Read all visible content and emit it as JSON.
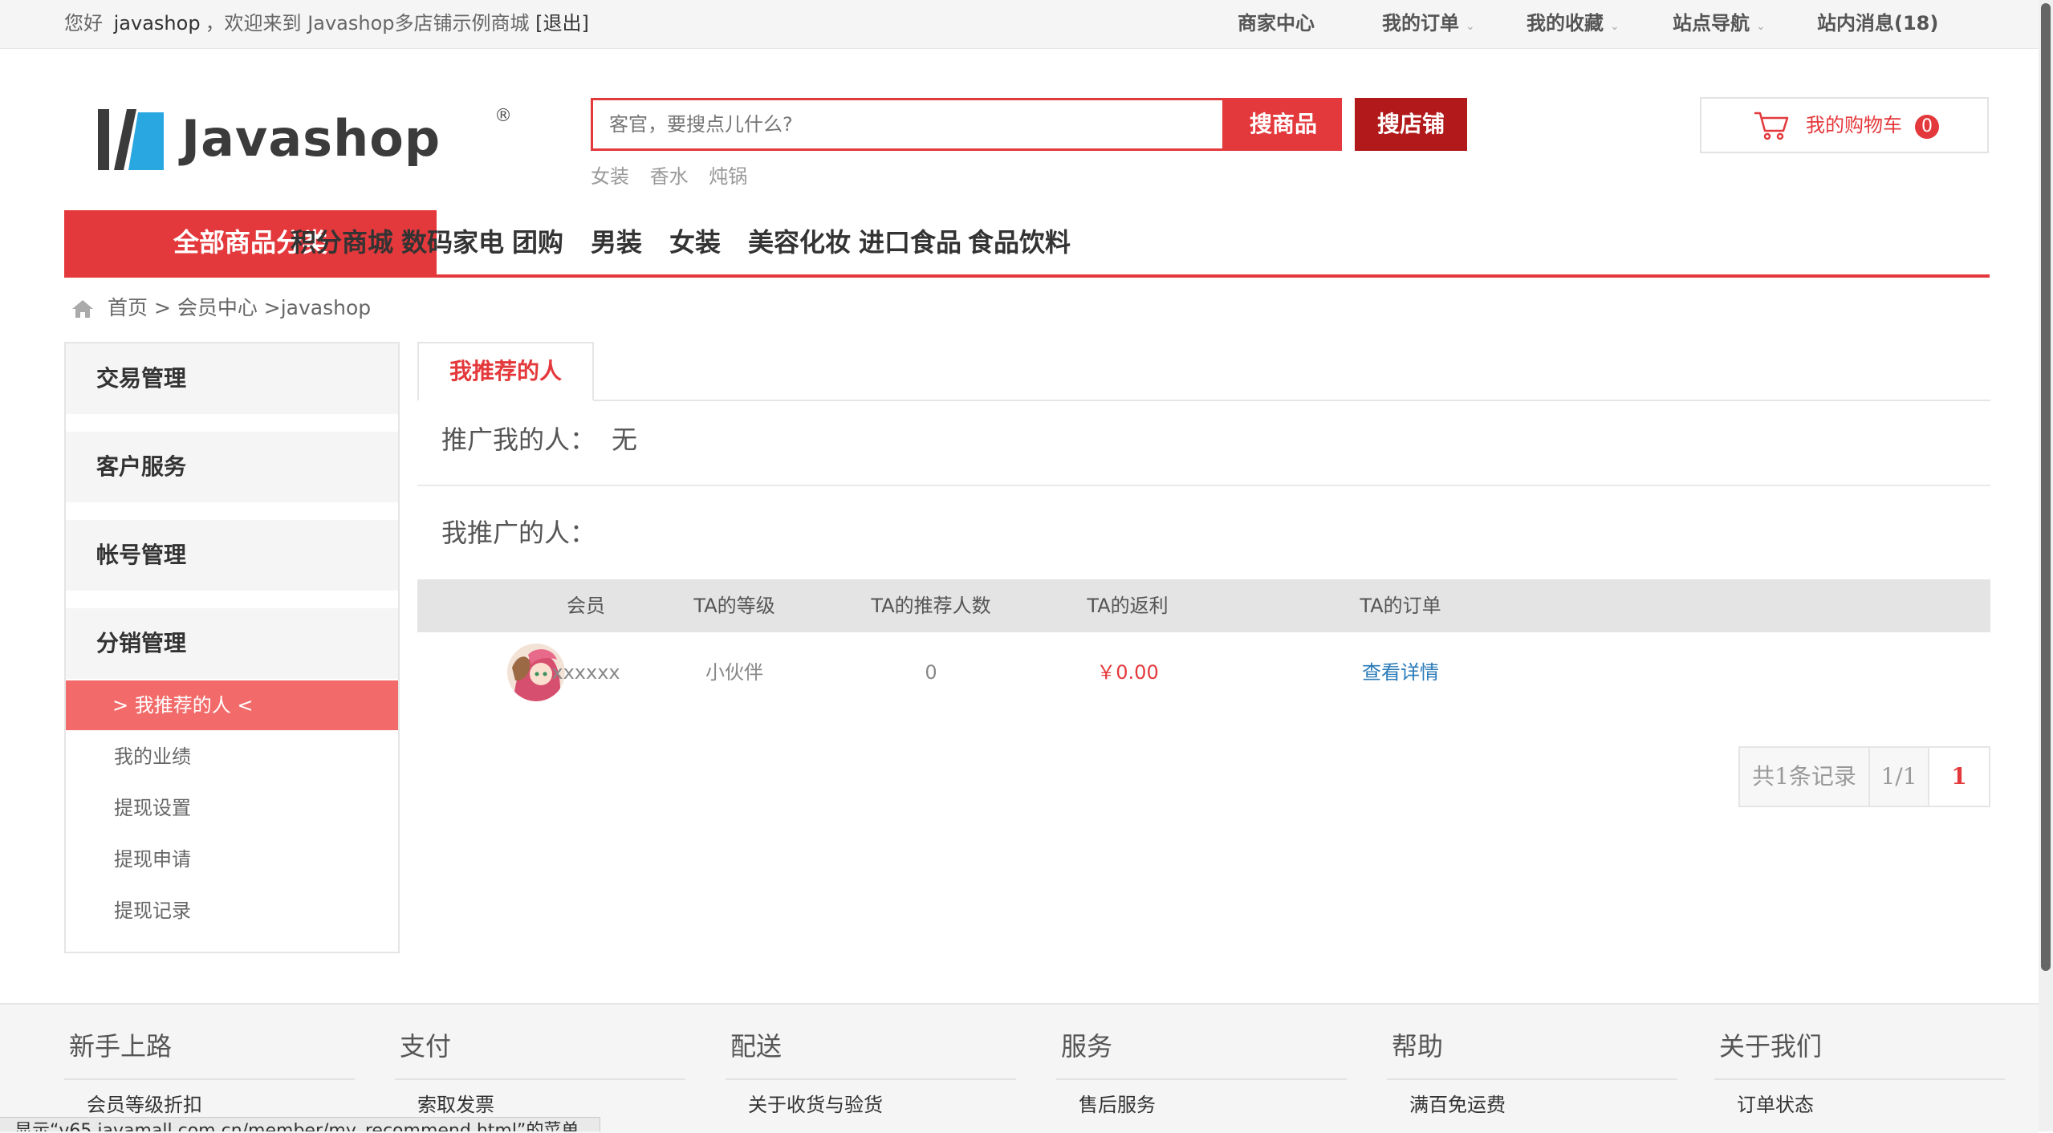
{
  "topbar": {
    "greeting": "您好",
    "username": "javashop",
    "welcome": "，欢迎来到 Javashop多店铺示例商城",
    "logout": "[退出]",
    "links": [
      {
        "label": "商家中心"
      },
      {
        "label": "我的订单"
      },
      {
        "label": "我的收藏"
      },
      {
        "label": "站点导航"
      },
      {
        "label": "站内消息(18)"
      }
    ]
  },
  "logo": {
    "text": "Javashop",
    "reg": "®"
  },
  "search": {
    "placeholder": "客官，要搜点儿什么?",
    "btn_goods": "搜商品",
    "btn_shop": "搜店铺",
    "hotwords": [
      "女装",
      "香水",
      "炖锅"
    ]
  },
  "cart": {
    "label": "我的购物车",
    "count": "0"
  },
  "nav": {
    "all_label": "全部商品分类",
    "items": [
      "积分商城",
      "数码家电",
      "团购",
      "男装",
      "女装",
      "美容化妆",
      "进口食品",
      "食品饮料"
    ]
  },
  "breadcrumb": {
    "text": "首页 > 会员中心 >javashop"
  },
  "sidebar": {
    "sections": [
      "交易管理",
      "客户服务",
      "帐号管理",
      "分销管理"
    ],
    "sub_items": [
      "> 我推荐的人 <",
      "我的业绩",
      "提现设置",
      "提现申请",
      "提现记录"
    ]
  },
  "content": {
    "tab": "我推荐的人",
    "referrer_label": "推广我的人：",
    "referrer_value": "无",
    "promoted_label": "我推广的人：",
    "table": {
      "headers": [
        "会员",
        "TA的等级",
        "TA的推荐人数",
        "TA的返利",
        "TA的订单"
      ],
      "rows": [
        {
          "member": "xxxxxx",
          "level": "小伙伴",
          "count": "0",
          "rebate": "￥0.00",
          "orders": "查看详情"
        }
      ]
    },
    "pager": {
      "total": "共1条记录",
      "pages": "1/1",
      "current": "1"
    }
  },
  "footer": {
    "columns": [
      {
        "title": "新手上路",
        "link": "会员等级折扣"
      },
      {
        "title": "支付",
        "link": "索取发票"
      },
      {
        "title": "配送",
        "link": "关于收货与验货"
      },
      {
        "title": "服务",
        "link": "售后服务"
      },
      {
        "title": "帮助",
        "link": "满百免运费"
      },
      {
        "title": "关于我们",
        "link": "订单状态"
      }
    ]
  },
  "statusbar": {
    "text": "显示“v65.javamall.com.cn/member/my_recommend.html”的菜单"
  },
  "colors": {
    "accent": "#e4393c",
    "dark_red": "#b1191a",
    "active_sub": "#f36a6a",
    "link_blue": "#2a7ab8"
  }
}
